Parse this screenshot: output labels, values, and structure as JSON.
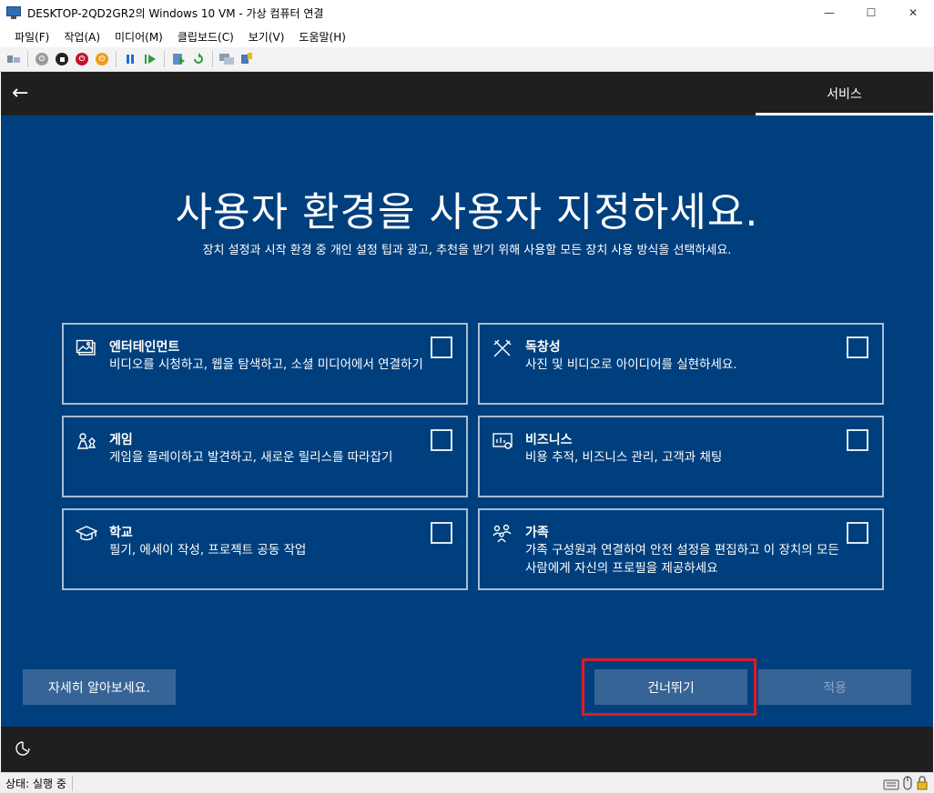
{
  "window": {
    "title": "DESKTOP-2QD2GR2의 Windows 10 VM - 가상 컴퓨터 연결",
    "minimize_glyph": "—",
    "maximize_glyph": "☐",
    "close_glyph": "✕"
  },
  "menu": {
    "items": [
      {
        "label": "파일(F)"
      },
      {
        "label": "작업(A)"
      },
      {
        "label": "미디어(M)"
      },
      {
        "label": "클립보드(C)"
      },
      {
        "label": "보기(V)"
      },
      {
        "label": "도움말(H)"
      }
    ]
  },
  "toolbar": {
    "icons": [
      "ctrl-alt-del-icon",
      "start-icon",
      "turn-off-icon",
      "shut-down-icon",
      "save-icon",
      "pause-icon",
      "resume-icon",
      "checkpoint-icon",
      "revert-icon",
      "enhanced-session-icon",
      "share-icon"
    ],
    "colors": {
      "stop": "#c8102e",
      "save": "#f29a1b",
      "pause": "#1d6fd1",
      "resume": "#2a9d3c"
    }
  },
  "oobe": {
    "back_glyph": "←",
    "tab_label": "서비스",
    "headline": "사용자 환경을 사용자 지정하세요.",
    "subline": "장치 설정과 시작 환경 중 개인 설정 팁과 광고, 추천을 받기 위해 사용할 모든 장치 사용 방식을 선택하세요.",
    "cards": [
      {
        "icon": "entertainment-icon",
        "title": "엔터테인먼트",
        "desc": "비디오를 시청하고, 웹을 탐색하고, 소셜 미디어에서 연결하기",
        "checked": false
      },
      {
        "icon": "creativity-icon",
        "title": "독창성",
        "desc": "사진 및 비디오로 아이디어를 실현하세요.",
        "checked": false
      },
      {
        "icon": "gaming-icon",
        "title": "게임",
        "desc": "게임을 플레이하고 발견하고, 새로운 릴리스를 따라잡기",
        "checked": false
      },
      {
        "icon": "business-icon",
        "title": "비즈니스",
        "desc": "비용 추적, 비즈니스 관리, 고객과 채팅",
        "checked": false
      },
      {
        "icon": "school-icon",
        "title": "학교",
        "desc": "필기, 에세이 작성, 프로젝트 공동 작업",
        "checked": false
      },
      {
        "icon": "family-icon",
        "title": "가족",
        "desc": "가족 구성원과 연결하여 안전 설정을 편집하고 이 장치의 모든 사람에게 자신의 프로필을 제공하세요",
        "checked": false
      }
    ],
    "learn_more": "자세히 알아보세요.",
    "skip": "건너뛰기",
    "apply": "적용",
    "colors": {
      "background": "#003f7d",
      "button": "#376496",
      "highlight": "#e01b24"
    }
  },
  "status": {
    "text": "상태: 실행 중"
  }
}
